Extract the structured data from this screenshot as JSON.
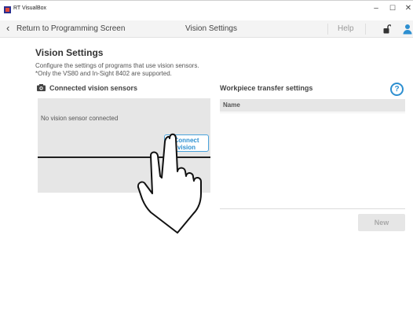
{
  "window": {
    "title": "RT VisualBox",
    "minimize_glyph": "–",
    "maximize_glyph": "☐",
    "close_glyph": "✕"
  },
  "header": {
    "back_label": "Return to Programming Screen",
    "screen_title": "Vision Settings",
    "help_label": "Help"
  },
  "page": {
    "title": "Vision Settings",
    "description_line1": "Configure the settings of programs that use vision sensors.",
    "description_line2": "*Only the VS80 and In-Sight 8402 are supported."
  },
  "sensors": {
    "heading": "Connected vision sensors",
    "empty_message": "No vision sensor connected",
    "connect_line1": "Connect",
    "connect_line2": "vision"
  },
  "workpiece": {
    "heading": "Workpiece transfer settings",
    "help_glyph": "?",
    "columns": [
      "Name"
    ],
    "rows": [],
    "new_label": "New"
  },
  "icons": {
    "back": "chevron-left-icon",
    "lock": "lock-open-icon",
    "user": "user-icon",
    "camera": "camera-icon",
    "help": "help-circle-icon",
    "hand": "pointing-hand-icon"
  },
  "colors": {
    "accent": "#2d8fd0",
    "panel_gray": "#e6e6e6",
    "disabled_text": "#a8a8a8"
  }
}
